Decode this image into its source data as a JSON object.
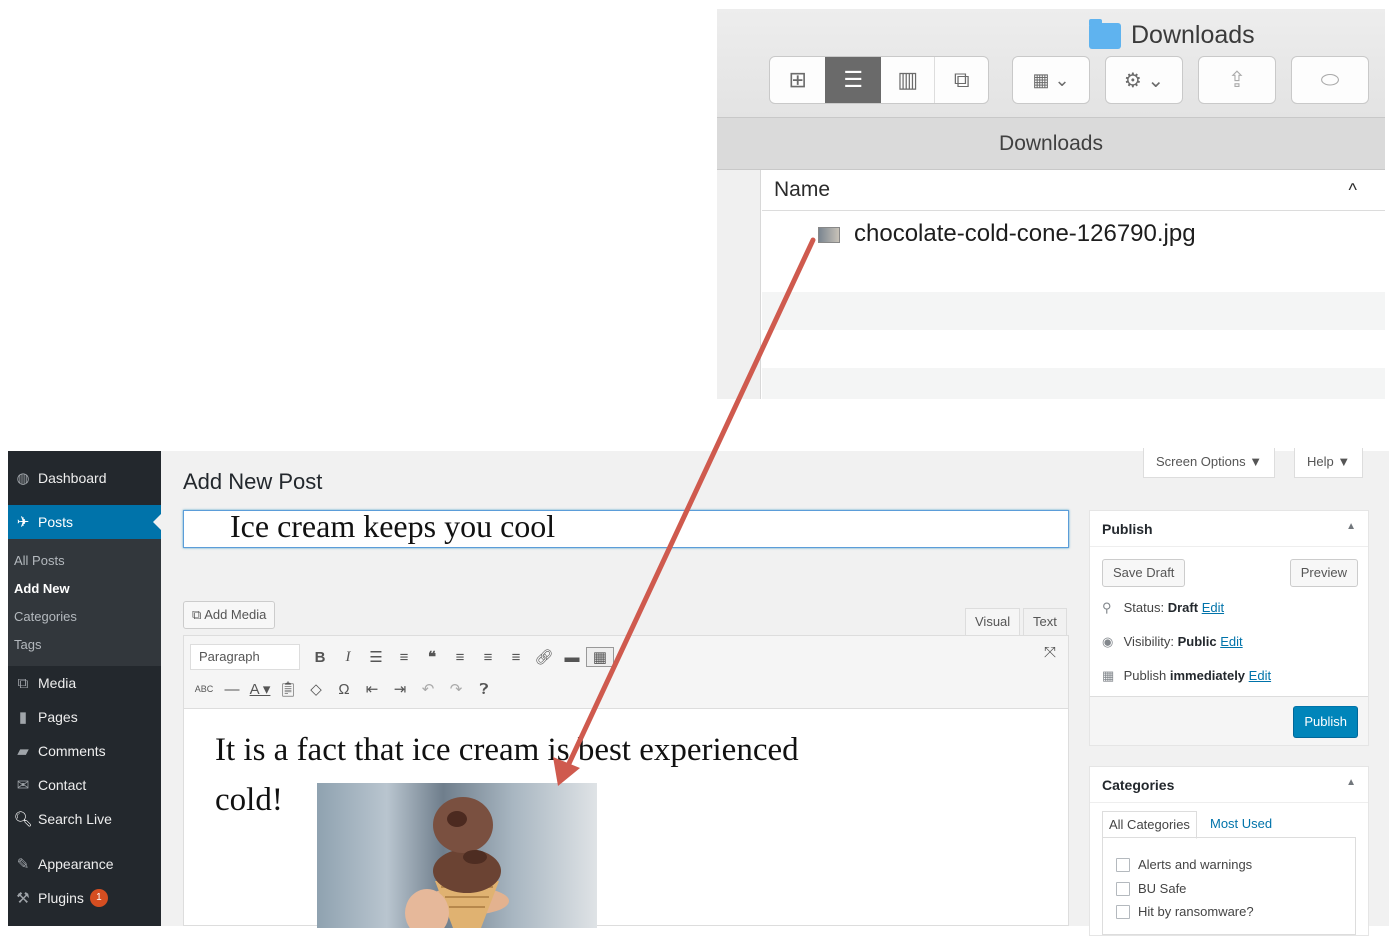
{
  "finder": {
    "window_title": "Downloads",
    "path_bar": "Downloads",
    "column_name": "Name",
    "sort_indicator": "^",
    "file_name": "chocolate-cold-cone-126790.jpg"
  },
  "wp": {
    "sidebar": {
      "dashboard": "Dashboard",
      "posts": "Posts",
      "all_posts": "All Posts",
      "add_new": "Add New",
      "categories": "Categories",
      "tags": "Tags",
      "media": "Media",
      "pages": "Pages",
      "comments": "Comments",
      "contact": "Contact",
      "search_live": "Search Live",
      "appearance": "Appearance",
      "plugins": "Plugins",
      "plugins_badge": "1"
    },
    "screen_options": "Screen Options ▼",
    "help": "Help ▼",
    "page_title": "Add New Post",
    "post_title": "Ice cream keeps you cool",
    "add_media": "Add Media",
    "tab_visual": "Visual",
    "tab_text": "Text",
    "format_select": "Paragraph",
    "editor_text_line1": "It is a fact that ice cream is best experienced",
    "editor_text_line2": "cold!",
    "publish": {
      "heading": "Publish",
      "save_draft": "Save Draft",
      "preview": "Preview",
      "status_label": "Status:",
      "status_value": "Draft",
      "visibility_label": "Visibility:",
      "visibility_value": "Public",
      "publish_label": "Publish",
      "publish_value": "immediately",
      "edit": "Edit",
      "publish_button": "Publish"
    },
    "categories": {
      "heading": "Categories",
      "tab_all": "All Categories",
      "tab_most_used": "Most Used",
      "items": [
        "Alerts and warnings",
        "BU Safe",
        "Hit by ransomware?"
      ]
    }
  },
  "colors": {
    "wp_sidebar": "#23282d",
    "wp_accent": "#0073aa",
    "arrow": "#cf5a4e",
    "finder_folder": "#5fb3ef"
  }
}
